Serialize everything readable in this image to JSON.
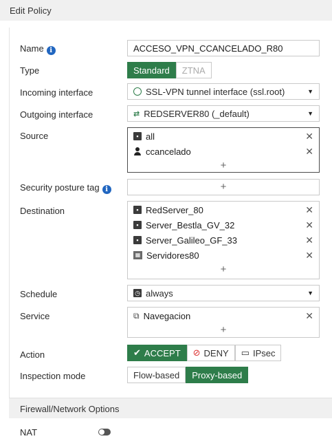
{
  "header": {
    "title": "Edit Policy"
  },
  "form": {
    "name": {
      "label": "Name",
      "value": "ACCESO_VPN_CCANCELADO_R80"
    },
    "type": {
      "label": "Type",
      "options": [
        "Standard",
        "ZTNA"
      ],
      "selected": "Standard"
    },
    "incoming_interface": {
      "label": "Incoming interface",
      "value": "SSL-VPN tunnel interface (ssl.root)"
    },
    "outgoing_interface": {
      "label": "Outgoing interface",
      "value": "REDSERVER80 (_default)"
    },
    "source": {
      "label": "Source",
      "entries": [
        "all",
        "ccancelado"
      ],
      "add": "+"
    },
    "security_posture_tag": {
      "label": "Security posture tag",
      "add": "+"
    },
    "destination": {
      "label": "Destination",
      "entries": [
        "RedServer_80",
        "Server_Bestla_GV_32",
        "Server_Galileo_GF_33",
        "Servidores80"
      ],
      "add": "+"
    },
    "schedule": {
      "label": "Schedule",
      "value": "always"
    },
    "service": {
      "label": "Service",
      "entries": [
        "Navegacion"
      ],
      "add": "+"
    },
    "action": {
      "label": "Action",
      "options": [
        "ACCEPT",
        "DENY",
        "IPsec"
      ],
      "selected": "ACCEPT"
    },
    "inspection_mode": {
      "label": "Inspection mode",
      "options": [
        "Flow-based",
        "Proxy-based"
      ],
      "selected": "Proxy-based"
    }
  },
  "firewall_section": {
    "title": "Firewall/Network Options",
    "nat": {
      "label": "NAT",
      "enabled": false
    }
  },
  "icons": {
    "info": "info-circle-icon",
    "remove": "close-icon",
    "caret": "caret-down-icon"
  },
  "colors": {
    "active_green": "#2e7d4a",
    "info_blue": "#2166c0",
    "deny_red": "#d33"
  }
}
